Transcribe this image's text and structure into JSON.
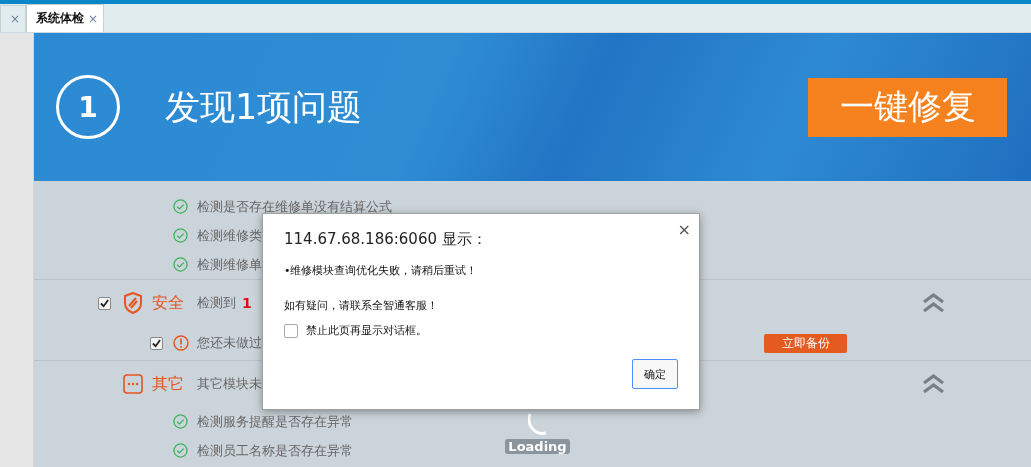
{
  "tabs": [
    {
      "selected": false,
      "close": "×"
    },
    {
      "label": "系统体检",
      "selected": true,
      "close": "×"
    }
  ],
  "header": {
    "step": "1",
    "title": "发现1项问题",
    "fix_button": "一键修复"
  },
  "items": [
    {
      "kind": "check",
      "text": "检测是否存在维修单没有结算公式"
    },
    {
      "kind": "check",
      "text": "检测维修类"
    },
    {
      "kind": "check",
      "text": "检测维修单"
    },
    {
      "kind": "security_group",
      "checked": true,
      "name": "安全",
      "summary": "检测到",
      "count": "1",
      "expanded": true
    },
    {
      "kind": "warning",
      "checked": true,
      "text": "您还未做过",
      "action": "立即备份"
    },
    {
      "kind": "other_group",
      "name": "其它",
      "summary": "其它模块未",
      "expanded": true
    },
    {
      "kind": "check",
      "text": "检测服务提醒是否存在异常"
    },
    {
      "kind": "check",
      "text": "检测员工名称是否存在异常"
    }
  ],
  "loading": {
    "text": "Loading"
  },
  "dialog": {
    "close": "×",
    "title": "114.67.68.186:6060 显示：",
    "message": "•维修模块查询优化失败，请稍后重试！",
    "note": "如有疑问，请联系全智通客服！",
    "suppress_label": "禁止此页再显示对话框。",
    "suppress_checked": false,
    "ok_button": "确定"
  }
}
